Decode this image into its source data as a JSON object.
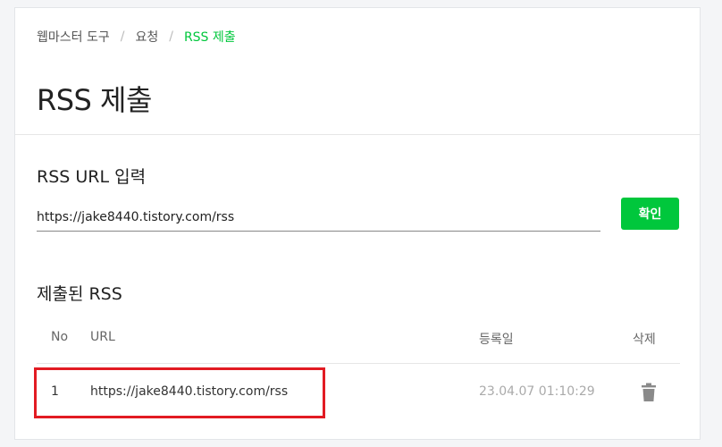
{
  "breadcrumb": {
    "items": [
      "웹마스터 도구",
      "요청",
      "RSS 제출"
    ],
    "separator": "/"
  },
  "page": {
    "title": "RSS 제출"
  },
  "rss_input": {
    "section_title": "RSS URL 입력",
    "value": "https://jake8440.tistory.com/rss",
    "confirm_label": "확인"
  },
  "submitted": {
    "section_title": "제출된 RSS",
    "columns": [
      "No",
      "URL",
      "등록일",
      "삭제"
    ],
    "rows": [
      {
        "no": "1",
        "url": "https://jake8440.tistory.com/rss",
        "date": "23.04.07 01:10:29",
        "delete_icon": "trash-icon"
      }
    ]
  },
  "colors": {
    "accent": "#00c73c",
    "highlight": "#e21b23"
  }
}
